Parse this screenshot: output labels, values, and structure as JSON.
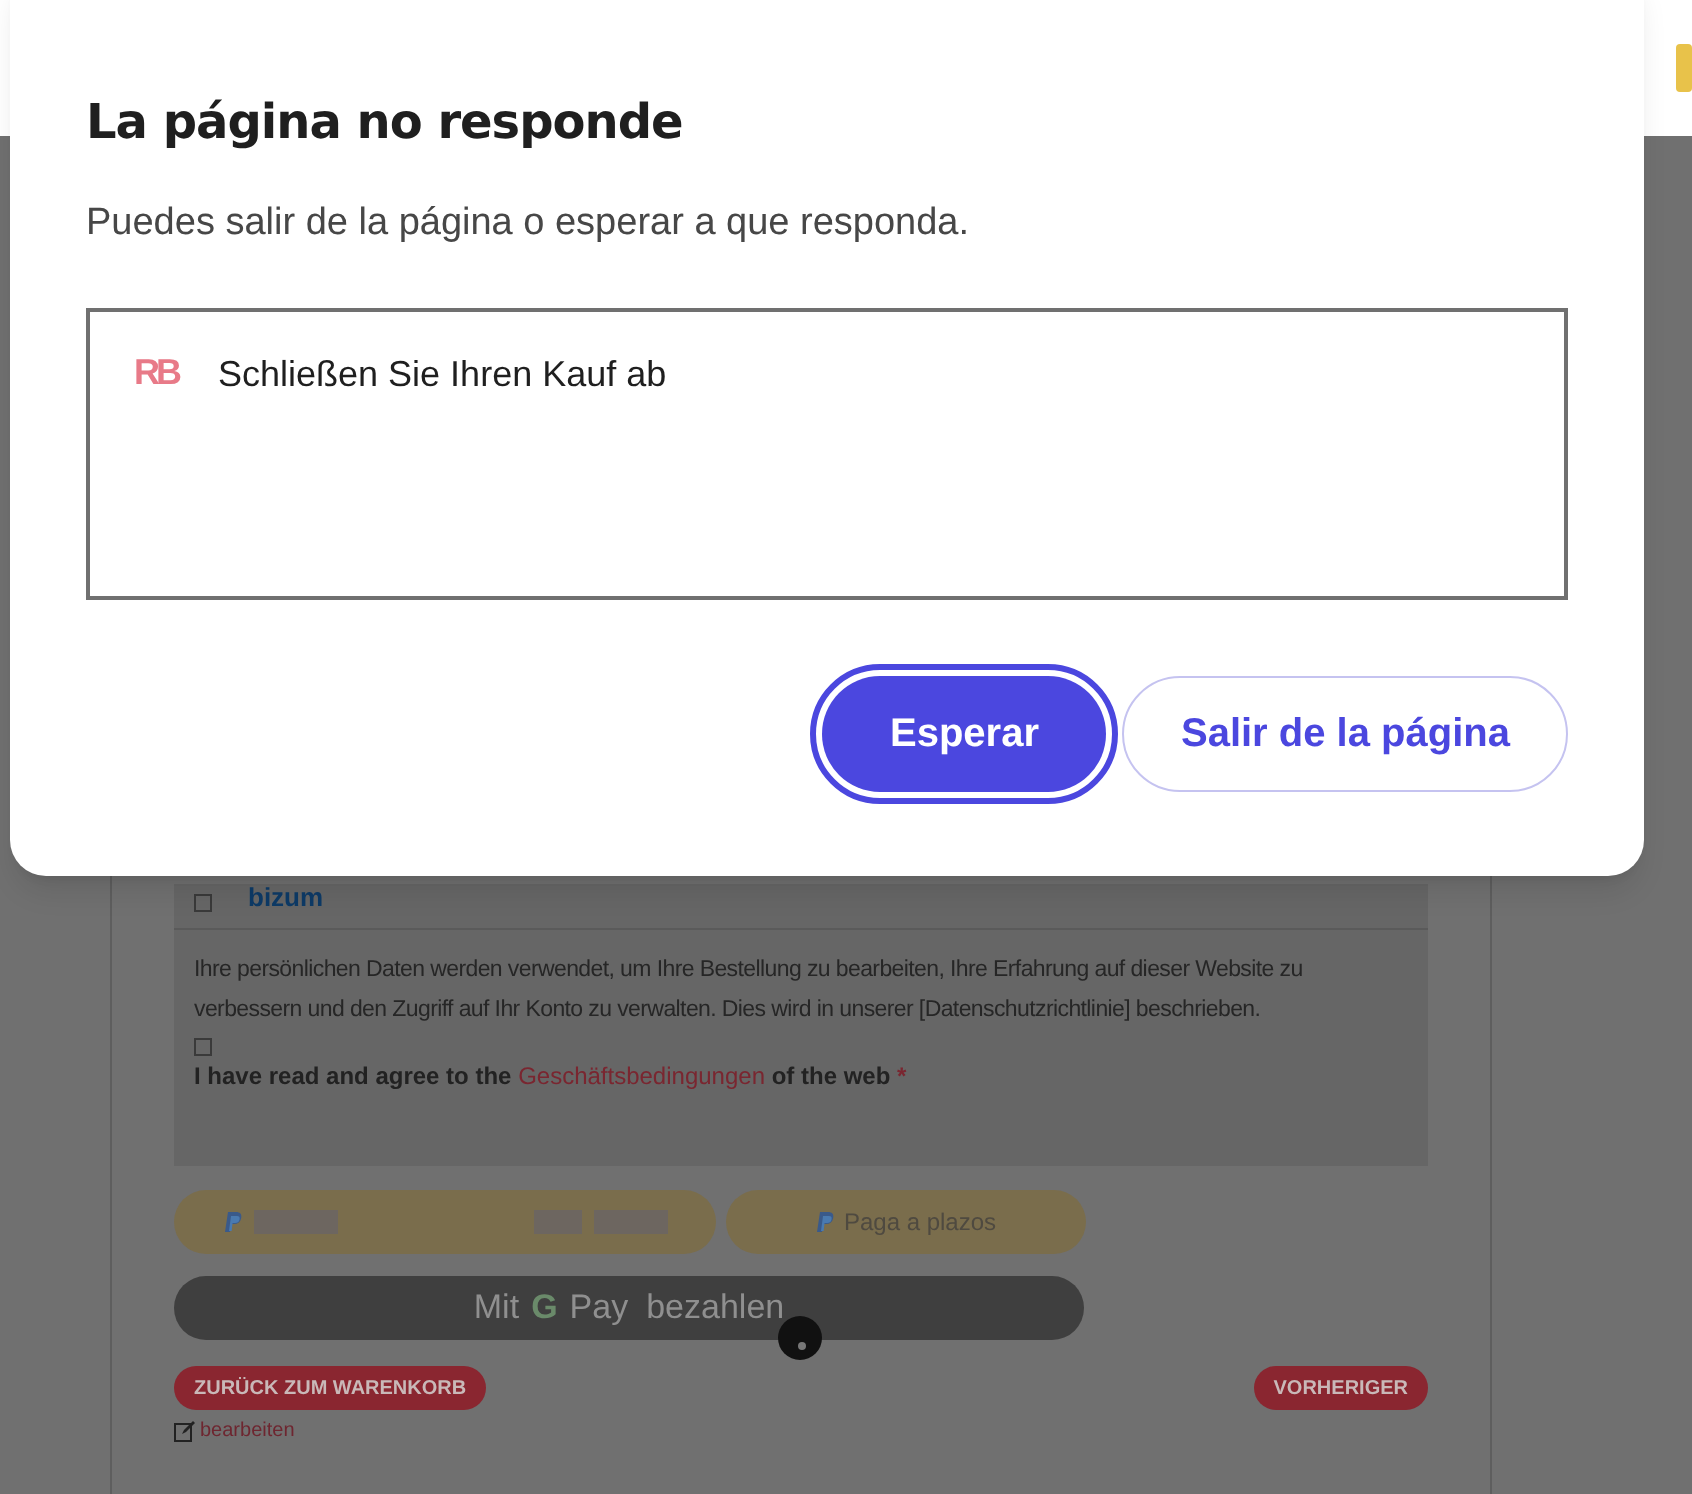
{
  "dialog": {
    "title": "La página no responde",
    "message": "Puedes salir de la página o esperar a que responda.",
    "page": {
      "favicon_text": "RB",
      "title": "Schließen Sie Ihren Kauf ab"
    },
    "buttons": [
      {
        "label": "Esperar",
        "selected": true
      },
      {
        "label": "Salir de la página",
        "selected": false
      }
    ]
  },
  "page": {
    "payment_option": {
      "label": "bizum",
      "checked": false
    },
    "privacy_text": "Ihre persönlichen Daten werden verwendet, um Ihre Bestellung zu bearbeiten, Ihre Erfahrung auf dieser Website zu verbessern und den Zugriff auf Ihr Konto zu verwalten. Dies wird in unserer [Datenschutzrichtlinie] beschrieben.",
    "terms": {
      "checked": false,
      "before": "I have read and agree to the",
      "link": "Geschäftsbedingungen",
      "after": "of the web",
      "required": "*"
    },
    "paypal_buttons": [
      {
        "kind": "redacted"
      },
      {
        "kind": "label",
        "label": "Paga a plazos"
      }
    ],
    "gpay": {
      "before": "Mit",
      "logo": "G",
      "pay": "Pay",
      "after": "bezahlen"
    },
    "back_button": "ZURÜCK ZUM WARENKORB",
    "previous_button": "VORHERIGER",
    "edit_link": "bearbeiten"
  }
}
